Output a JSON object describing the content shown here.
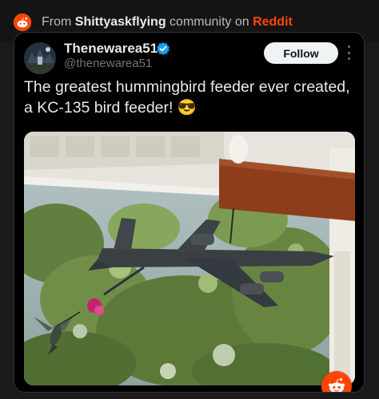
{
  "header": {
    "prefix": "From ",
    "community": "Shittyaskflying",
    "middle": " community on ",
    "brand": "Reddit"
  },
  "tweet": {
    "author_name": "Thenewarea51",
    "author_handle": "@thenewarea51",
    "follow_label": "Follow",
    "text": "The greatest hummingbird feeder ever created, a KC-135 bird feeder! 😎",
    "verified": true
  },
  "icons": {
    "header_logo": "reddit-logo-icon",
    "verified": "verified-badge-icon",
    "more": "more-options-icon",
    "badge": "reddit-snoo-icon"
  },
  "colors": {
    "reddit_orange": "#ff4500",
    "verified_blue": "#1d9bf0",
    "page_bg": "#1a1a1b",
    "card_bg": "#000000"
  }
}
